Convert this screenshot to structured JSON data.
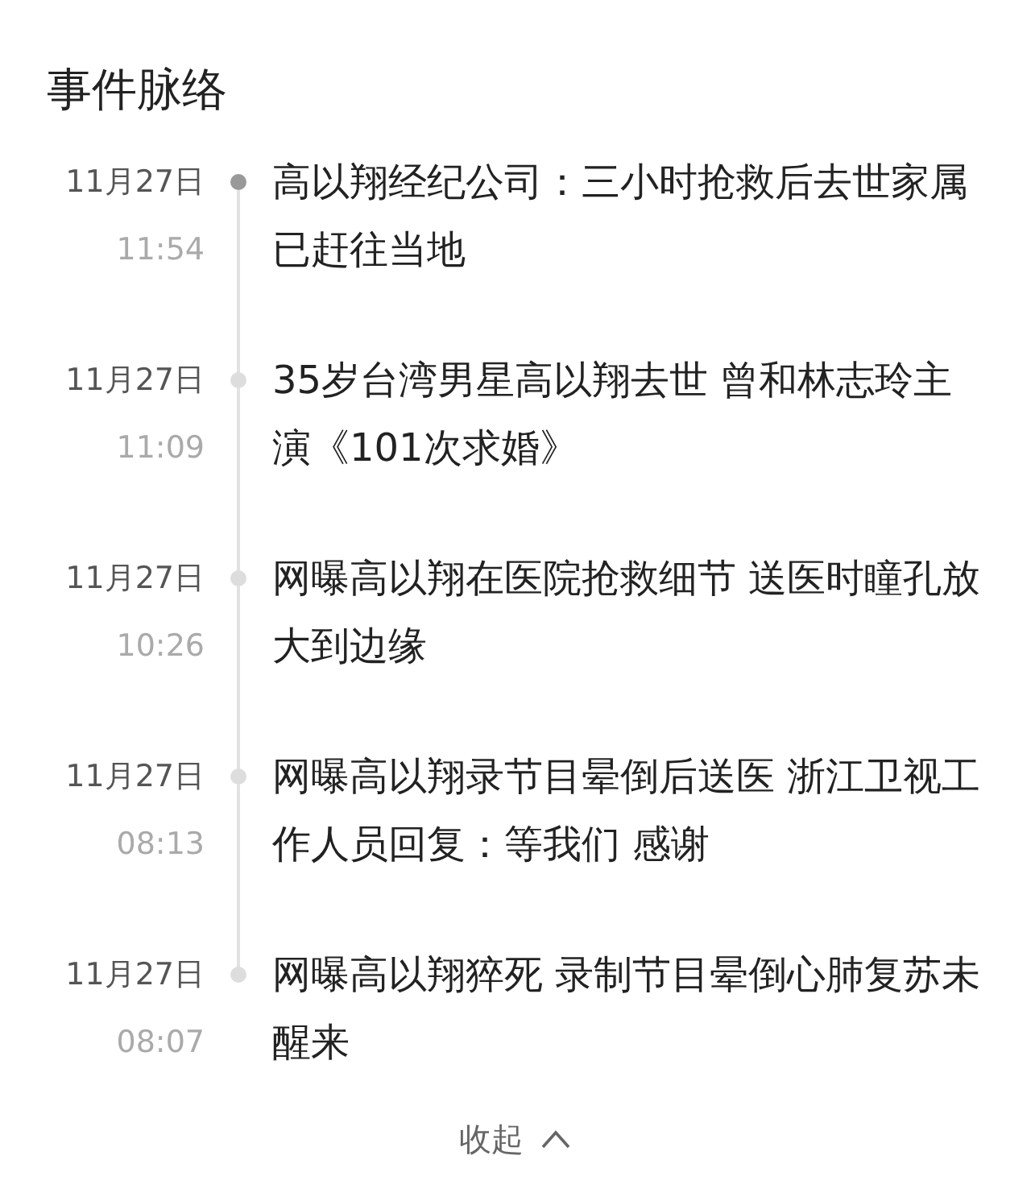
{
  "title": "事件脉络",
  "events": [
    {
      "date": "11月27日",
      "time": "11:54",
      "text": "高以翔经纪公司：三小时抢救后去世家属已赶往当地",
      "latest": true
    },
    {
      "date": "11月27日",
      "time": "11:09",
      "text": "35岁台湾男星高以翔去世 曾和林志玲主演《101次求婚》",
      "latest": false
    },
    {
      "date": "11月27日",
      "time": "10:26",
      "text": "网曝高以翔在医院抢救细节 送医时瞳孔放大到边缘",
      "latest": false
    },
    {
      "date": "11月27日",
      "time": "08:13",
      "text": "网曝高以翔录节目晕倒后送医 浙江卫视工作人员回复：等我们 感谢",
      "latest": false
    },
    {
      "date": "11月27日",
      "time": "08:07",
      "text": "网曝高以翔猝死 录制节目晕倒心肺复苏未醒来",
      "latest": false
    }
  ],
  "collapse": {
    "label": "收起"
  }
}
